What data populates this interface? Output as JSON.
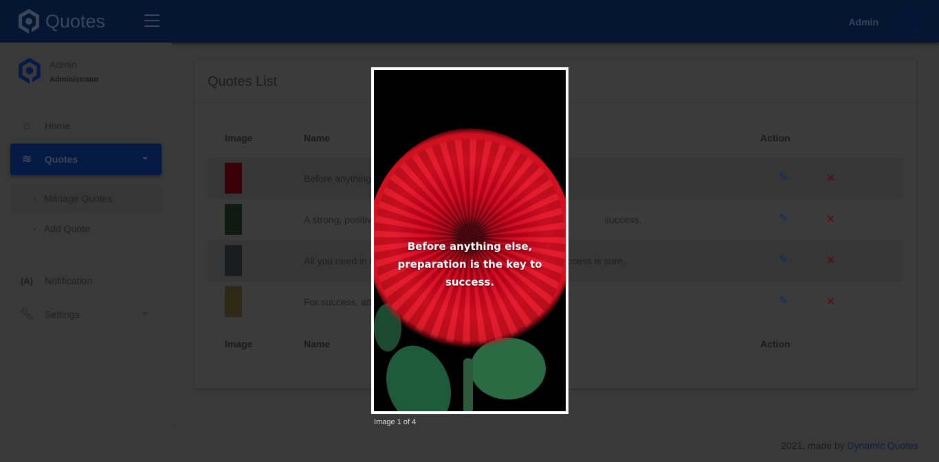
{
  "header": {
    "brand": "Quotes",
    "user": "Admin"
  },
  "sidebar": {
    "user_name": "Admin",
    "user_role": "Administrator",
    "items": [
      {
        "label": "Home"
      },
      {
        "label": "Quotes"
      },
      {
        "label": "Notification"
      },
      {
        "label": "Settings"
      }
    ],
    "sub_items": [
      {
        "label": "Manage Quotes"
      },
      {
        "label": "Add Quote"
      }
    ]
  },
  "card": {
    "title": "Quotes List",
    "columns": {
      "image": "Image",
      "name": "Name",
      "action": "Action"
    },
    "rows": [
      {
        "text_left": "Before anything",
        "text_right": "",
        "thumb_color": "#3a0008"
      },
      {
        "text_left": "A strong, positiv",
        "text_right": "success.",
        "thumb_color": "#0e1a12"
      },
      {
        "text_left": "All you need in t",
        "text_right": "ccess is sure.",
        "thumb_color": "#1a1d20"
      },
      {
        "text_left": "For success, atti",
        "text_right": "",
        "thumb_color": "#2f2a14"
      }
    ]
  },
  "lightbox": {
    "quote": "Before anything else, preparation is the key to success.",
    "caption": "Image 1 of 4"
  },
  "footer": {
    "text": "2021, made by",
    "link": "Dynamic Quotes"
  }
}
